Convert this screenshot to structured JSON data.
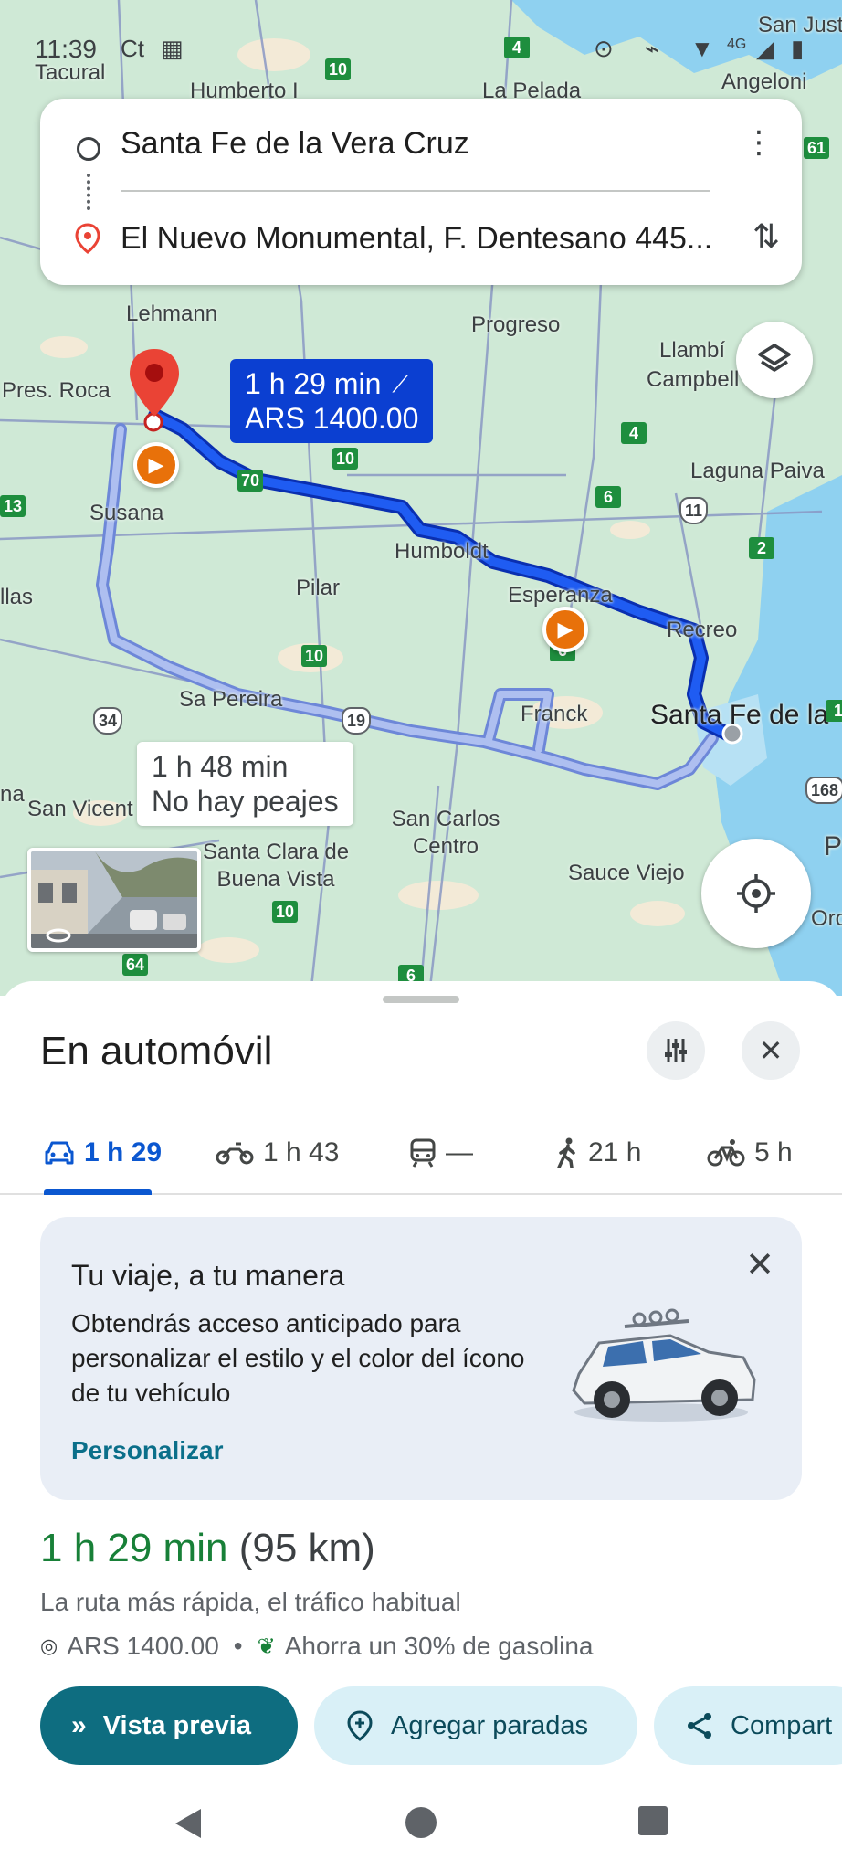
{
  "status_bar": {
    "time": "11:39",
    "carrier_icon": "Ct",
    "network": "4G"
  },
  "route_card": {
    "origin": "Santa Fe de la Vera Cruz",
    "destination": "El Nuevo Monumental, F. Dentesano 445..."
  },
  "map": {
    "places": {
      "tacural": "Tacural",
      "humberto": "Humberto I",
      "la_pelada": "La Pelada",
      "san_justo": "San Just",
      "angeloni": "Angeloni",
      "lehmann": "Lehmann",
      "progreso": "Progreso",
      "llambi": "Llambí",
      "campbell": "Campbell",
      "pres_roca": "Pres. Roca",
      "laguna_paiva": "Laguna Paiva",
      "susana": "Susana",
      "humboldt": "Humboldt",
      "pilar": "Pilar",
      "esperanza": "Esperanza",
      "recreo": "Recreo",
      "llas": "llas",
      "sa_pereira": "Sa Pereira",
      "franck": "Franck",
      "santa_fe": "Santa Fe de la Vera Cruz",
      "san_vicente": "San Vicent",
      "na": "na",
      "san_carlos": "San Carlos Centro",
      "santa_clara": "Santa Clara de Buena Vista",
      "sauce_viejo": "Sauce Viejo",
      "oro": "Oro",
      "p": "P"
    },
    "shields": [
      "10",
      "4",
      "61",
      "70",
      "10",
      "4",
      "6",
      "11",
      "2",
      "13",
      "10",
      "34",
      "19",
      "6",
      "168",
      "10",
      "64",
      "6",
      "1"
    ],
    "callout_fast": {
      "duration": "1 h 29 min",
      "toll": "ARS 1400.00"
    },
    "callout_alt": {
      "duration": "1 h 48 min",
      "toll": "No hay peajes"
    }
  },
  "sheet": {
    "title": "En automóvil",
    "modes": [
      {
        "icon": "car-icon",
        "label": "1 h 29"
      },
      {
        "icon": "motorcycle-icon",
        "label": "1 h 43"
      },
      {
        "icon": "train-icon",
        "label": "—"
      },
      {
        "icon": "walk-icon",
        "label": "21 h"
      },
      {
        "icon": "bike-icon",
        "label": "5 h"
      }
    ],
    "promo": {
      "title": "Tu viaje, a tu manera",
      "body": "Obtendrás acceso anticipado para personalizar el estilo y el color del ícono de tu vehículo",
      "link": "Personalizar"
    },
    "summary": {
      "duration": "1 h 29 min",
      "distance": "(95 km)",
      "description": "La ruta más rápida, el tráfico habitual",
      "toll": "ARS 1400.00",
      "separator": "•",
      "savings": "Ahorra un 30% de gasolina"
    },
    "actions": {
      "preview": "Vista previa",
      "add_stops": "Agregar paradas",
      "share": "Compart"
    }
  },
  "colors": {
    "route_primary": "#0b3fd1",
    "route_alt": "#8ea9ee",
    "duration_green": "#188038",
    "preview_button": "#0e6d80",
    "map_land": "#cfe9d6",
    "water": "#8fd1f0"
  }
}
